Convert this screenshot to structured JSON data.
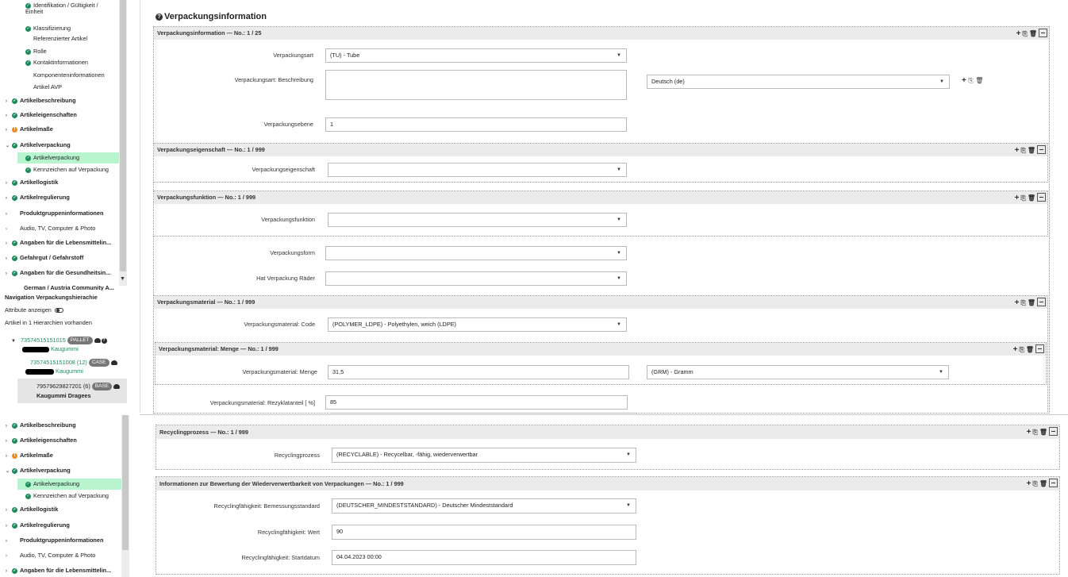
{
  "sidebar_top": {
    "items": [
      {
        "label": "Identifikation / Gültigkeit / Einheit",
        "status": "ok"
      },
      {
        "label": "Klassifizierung",
        "status": "ok"
      },
      {
        "label": "Referenzierter Artikel",
        "status": "none"
      },
      {
        "label": "Rolle",
        "status": "ok"
      },
      {
        "label": "Kontaktinformationen",
        "status": "ok"
      },
      {
        "label": "Komponenteninformationen",
        "status": "none"
      },
      {
        "label": "Artikel AVP",
        "status": "none"
      },
      {
        "label": "Artikelbeschreibung",
        "status": "ok"
      },
      {
        "label": "Artikeleigenschaften",
        "status": "ok"
      },
      {
        "label": "Artikelmaße",
        "status": "warn"
      },
      {
        "label": "Artikelverpackung",
        "status": "ok"
      },
      {
        "label": "Artikelverpackung",
        "status": "ok"
      },
      {
        "label": "Kennzeichen auf Verpackung",
        "status": "ok"
      },
      {
        "label": "Artikellogistik",
        "status": "ok"
      },
      {
        "label": "Artikelregulierung",
        "status": "ok"
      },
      {
        "label": "Produktgruppeninformationen",
        "status": "none"
      },
      {
        "label": "Audio, TV, Computer & Photo",
        "status": "none"
      },
      {
        "label": "Angaben für die Lebensmittelin...",
        "status": "ok"
      },
      {
        "label": "Gefahrgut / Gefahrstoff",
        "status": "ok"
      },
      {
        "label": "Angaben für die Gesundheitsin...",
        "status": "ok"
      },
      {
        "label": "German / Austria Community A...",
        "status": "none"
      }
    ]
  },
  "hierarchy": {
    "title": "Navigation Verpackungshierachie",
    "attr_label": "Attribute anzeigen",
    "count_label": "Artikel in 1 Hierarchien vorhanden",
    "nodes": [
      {
        "gtin": "73574515151015",
        "tag": "PALLET",
        "name": "Kaugummi"
      },
      {
        "gtin": "73574515151008 (12)",
        "tag": "CASE",
        "name": "Kaugummi"
      },
      {
        "gtin": "79579629827201 (6)",
        "tag": "BASE",
        "name": "Kaugummi Dragees"
      }
    ]
  },
  "sidebar_bottom": {
    "items": [
      {
        "label": "Artikelbeschreibung",
        "status": "ok"
      },
      {
        "label": "Artikeleigenschaften",
        "status": "ok"
      },
      {
        "label": "Artikelmaße",
        "status": "warn"
      },
      {
        "label": "Artikelverpackung",
        "status": "ok"
      },
      {
        "label": "Artikelverpackung",
        "status": "ok"
      },
      {
        "label": "Kennzeichen auf Verpackung",
        "status": "ok"
      },
      {
        "label": "Artikellogistik",
        "status": "ok"
      },
      {
        "label": "Artikelregulierung",
        "status": "ok"
      },
      {
        "label": "Produktgruppeninformationen",
        "status": "none"
      },
      {
        "label": "Audio, TV, Computer & Photo",
        "status": "none"
      },
      {
        "label": "Angaben für die Lebensmittelin...",
        "status": "ok"
      }
    ]
  },
  "main": {
    "page_title": "Verpackungsinformation",
    "sections": {
      "vi": "Verpackungsinformation — No.: 1 / 25",
      "ve": "Verpackungseigenschaft — No.: 1 / 999",
      "vf": "Verpackungsfunktion — No.: 1 / 999",
      "vm": "Verpackungsmaterial — No.: 1 / 999",
      "vmm": "Verpackungsmaterial: Menge — No.: 1 / 999",
      "rp": "Recyclingprozess — No.: 1 / 999",
      "iw": "Informationen zur Bewertung der Wiederverwertbarkeit von Verpackungen — No.: 1 / 999"
    },
    "fields": {
      "verpackungsart": {
        "label": "Verpackungsart",
        "value": "(TU) - Tube"
      },
      "beschreibung": {
        "label": "Verpackungsart: Beschreibung",
        "value": "",
        "lang": "Deutsch (de)"
      },
      "ebene": {
        "label": "Verpackungsebene",
        "value": "1"
      },
      "eigenschaft": {
        "label": "Verpackungseigenschaft",
        "value": ""
      },
      "funktion": {
        "label": "Verpackungsfunktion",
        "value": ""
      },
      "form": {
        "label": "Verpackungsform",
        "value": ""
      },
      "raeder": {
        "label": "Hat Verpackung Räder",
        "value": ""
      },
      "mat_code": {
        "label": "Verpackungsmaterial: Code",
        "value": "(POLYMER_LDPE) - Polyethylen, weich (LDPE)"
      },
      "mat_menge": {
        "label": "Verpackungsmaterial: Menge",
        "value": "31,5",
        "unit": "(GRM) - Gramm"
      },
      "rezyklat": {
        "label": "Verpackungsmaterial: Rezyklatanteil [ %]",
        "value": "85"
      },
      "recycling": {
        "label": "Recyclingprozess",
        "value": "(RECYCLABLE) - Recycelbar, -fähig, wiederverwertbar"
      },
      "standard": {
        "label": "Recyclingfähigkeit: Bemessungsstandard",
        "value": "(DEUTSCHER_MINDESTSTANDARD) - Deutscher Mindeststandard"
      },
      "wert": {
        "label": "Recyclingfähigkeit: Wert",
        "value": "90"
      },
      "startdatum": {
        "label": "Recyclingfähigkeit: Startdatum",
        "value": "04.04.2023 00:00"
      }
    },
    "colors": {
      "ok": "#1d8a5c",
      "warn": "#f08a1c",
      "selected": "#b8f5cf",
      "header": "#ebebeb"
    }
  }
}
